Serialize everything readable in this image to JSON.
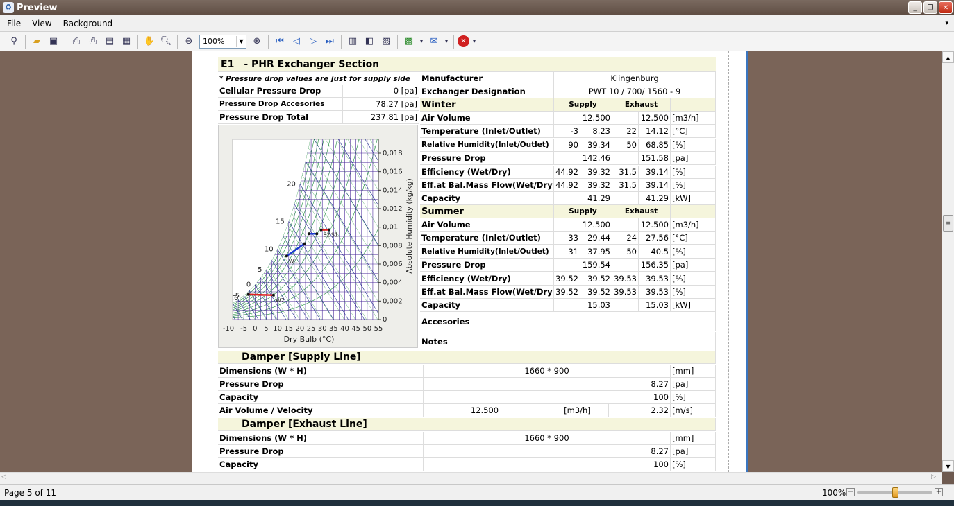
{
  "window": {
    "title": "Preview"
  },
  "menu": [
    {
      "label": "File"
    },
    {
      "label": "View"
    },
    {
      "label": "Background"
    }
  ],
  "toolbar": {
    "zoom": "100%"
  },
  "section": {
    "code": "E1",
    "title": "- PHR Exchanger Section"
  },
  "left": {
    "note": "* Pressure drop values are just for supply side",
    "rows": [
      {
        "label": "Cellular Pressure Drop",
        "value": "0 [pa]"
      },
      {
        "label": "Pressure Drop Accesories",
        "value": "78.27 [pa]"
      },
      {
        "label": "Pressure Drop Total",
        "value": "237.81 [pa]"
      }
    ]
  },
  "right": {
    "manufacturer": {
      "label": "Manufacturer",
      "value": "Klingenburg"
    },
    "designation": {
      "label": "Exchanger Designation",
      "value": "PWT 10 / 700/ 1560 - 9"
    },
    "winter": {
      "title": "Winter",
      "supply": "Supply",
      "exhaust": "Exhaust",
      "rows": [
        {
          "label": "Air Volume",
          "s1": "",
          "s2": "12.500",
          "e1": "",
          "e2": "12.500",
          "unit": "[m3/h]"
        },
        {
          "label": "Temperature (Inlet/Outlet)",
          "s1": "-3",
          "s2": "8.23",
          "e1": "22",
          "e2": "14.12",
          "unit": "[°C]"
        },
        {
          "label": "Relative Humidity(Inlet/Outlet)",
          "s1": "90",
          "s2": "39.34",
          "e1": "50",
          "e2": "68.85",
          "unit": "[%]"
        },
        {
          "label": "Pressure Drop",
          "s1": "",
          "s2": "142.46",
          "e1": "",
          "e2": "151.58",
          "unit": "[pa]"
        },
        {
          "label": "Efficiency (Wet/Dry)",
          "s1": "44.92",
          "s2": "39.32",
          "e1": "31.5",
          "e2": "39.14",
          "unit": "[%]"
        },
        {
          "label": "Eff.at Bal.Mass Flow(Wet/Dry)",
          "s1": "44.92",
          "s2": "39.32",
          "e1": "31.5",
          "e2": "39.14",
          "unit": "[%]"
        },
        {
          "label": "Capacity",
          "s1": "",
          "s2": "41.29",
          "e1": "",
          "e2": "41.29",
          "unit": "[kW]"
        }
      ]
    },
    "summer": {
      "title": "Summer",
      "supply": "Supply",
      "exhaust": "Exhaust",
      "rows": [
        {
          "label": "Air Volume",
          "s1": "",
          "s2": "12.500",
          "e1": "",
          "e2": "12.500",
          "unit": "[m3/h]"
        },
        {
          "label": "Temperature (Inlet/Outlet)",
          "s1": "33",
          "s2": "29.44",
          "e1": "24",
          "e2": "27.56",
          "unit": "[°C]"
        },
        {
          "label": "Relative Humidity(Inlet/Outlet)",
          "s1": "31",
          "s2": "37.95",
          "e1": "50",
          "e2": "40.5",
          "unit": "[%]"
        },
        {
          "label": "Pressure Drop",
          "s1": "",
          "s2": "159.54",
          "e1": "",
          "e2": "156.35",
          "unit": "[pa]"
        },
        {
          "label": "Efficiency (Wet/Dry)",
          "s1": "39.52",
          "s2": "39.52",
          "e1": "39.53",
          "e2": "39.53",
          "unit": "[%]"
        },
        {
          "label": "Eff.at Bal.Mass Flow(Wet/Dry)",
          "s1": "39.52",
          "s2": "39.52",
          "e1": "39.53",
          "e2": "39.53",
          "unit": "[%]"
        },
        {
          "label": "Capacity",
          "s1": "",
          "s2": "15.03",
          "e1": "",
          "e2": "15.03",
          "unit": "[kW]"
        }
      ]
    },
    "accesories": "Accesories",
    "notes": "Notes"
  },
  "chart": {
    "xlabel": "Dry Bulb (°C)",
    "ylabel": "Absolute Humidity (kg/kg)",
    "xticks": [
      "-10",
      "-5",
      "0",
      "5",
      "10",
      "15",
      "20",
      "25",
      "30",
      "35",
      "40",
      "45",
      "50",
      "55"
    ],
    "yticks": [
      "0",
      "0,002",
      "0,004",
      "0,006",
      "0,008",
      "0,01",
      "0,012",
      "0,014",
      "0,016",
      "0,018"
    ],
    "wetbulb_labels": [
      "0",
      "-5",
      "5",
      "10",
      "15",
      "20"
    ],
    "partial_label_left": ".0",
    "point_labels": [
      "W2",
      "W1",
      "S2",
      "S1"
    ]
  },
  "damper_supply": {
    "title": "Damper [Supply Line]",
    "dimensions": {
      "label": "Dimensions (W * H)",
      "value": "1660 * 900",
      "unit": "[mm]"
    },
    "pressure": {
      "label": "Pressure Drop",
      "value": "8.27",
      "unit": "[pa]"
    },
    "capacity": {
      "label": "Capacity",
      "value": "100",
      "unit": "[%]"
    },
    "air": {
      "label": "Air Volume / Velocity",
      "value": "12.500",
      "unit1": "[m3/h]",
      "value2": "2.32",
      "unit2": "[m/s]"
    }
  },
  "damper_exhaust": {
    "title": "Damper [Exhaust Line]",
    "dimensions": {
      "label": "Dimensions (W * H)",
      "value": "1660 * 900",
      "unit": "[mm]"
    },
    "pressure": {
      "label": "Pressure Drop",
      "value": "8.27",
      "unit": "[pa]"
    },
    "capacity": {
      "label": "Capacity",
      "value": "100",
      "unit": "[%]"
    }
  },
  "status": {
    "page": "Page 5 of 11",
    "zoom": "100%",
    "zoom_level": 0.5
  }
}
